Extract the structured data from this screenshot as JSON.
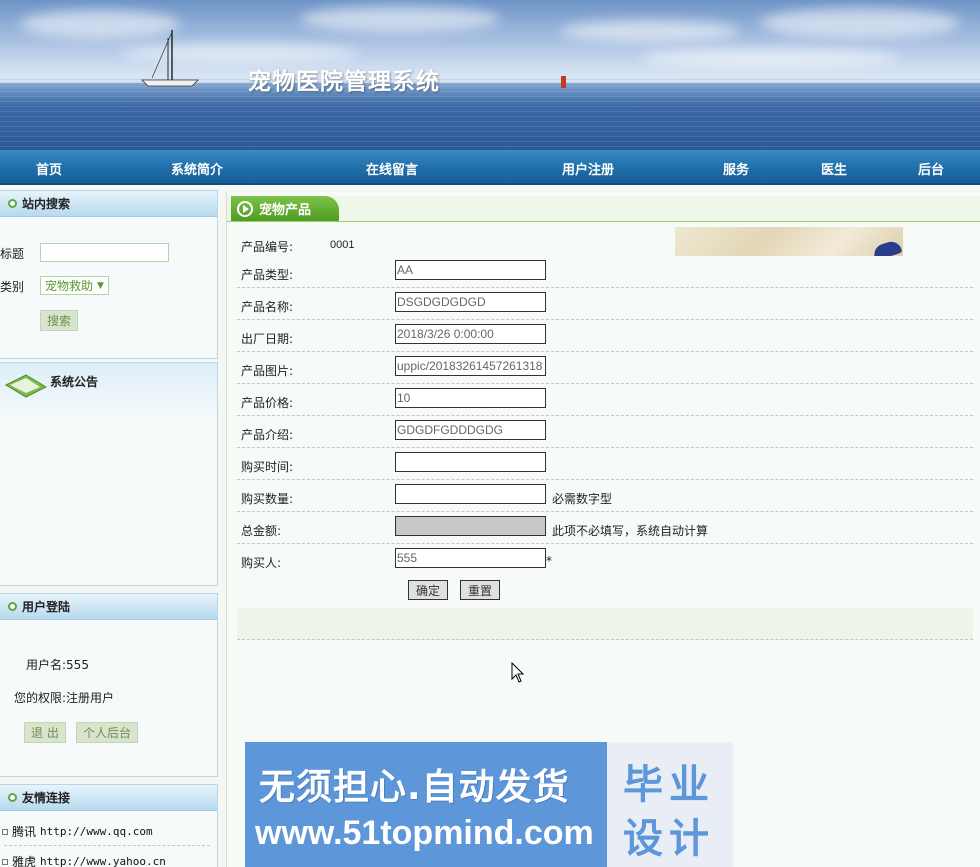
{
  "header": {
    "title": "宠物医院管理系统"
  },
  "nav": {
    "items": [
      "首页",
      "系统简介",
      "在线留言",
      "用户注册",
      "服务",
      "医生",
      "后台"
    ]
  },
  "sidebar": {
    "search": {
      "heading": "站内搜索",
      "title_label": "标题",
      "title_value": "",
      "category_label": "类别",
      "category_value": "宠物救助",
      "search_button": "搜索"
    },
    "notice": {
      "heading": "系统公告"
    },
    "login": {
      "heading": "用户登陆",
      "username_text": "用户名:555",
      "role_text": "您的权限:注册用户",
      "logout_button": "退 出",
      "personal_button": "个人后台"
    },
    "links": {
      "heading": "友情连接",
      "items": [
        {
          "name": "腾讯",
          "url": "http://www.qq.com"
        },
        {
          "name": "雅虎",
          "url": "http://www.yahoo.cn"
        }
      ]
    }
  },
  "main": {
    "tab_label": "宠物产品",
    "product_code_label": "产品编号:",
    "product_code_value": "0001",
    "fields": [
      {
        "label": "产品类型:",
        "value": "AA"
      },
      {
        "label": "产品名称:",
        "value": "DSGDGDGDGD"
      },
      {
        "label": "出厂日期:",
        "value": "2018/3/26 0:00:00"
      },
      {
        "label": "产品图片:",
        "value": "uppic/20183261457261318"
      },
      {
        "label": "产品价格:",
        "value": "10"
      },
      {
        "label": "产品介绍:",
        "value": "GDGDFGDDDGDG"
      },
      {
        "label": "购买时间:",
        "value": ""
      },
      {
        "label": "购买数量:",
        "value": "",
        "note": "必需数字型"
      },
      {
        "label": "总金额:",
        "value": "",
        "note": "此项不必填写，系统自动计算"
      },
      {
        "label": "购买人:",
        "value": "555",
        "note": "*"
      }
    ],
    "confirm_button": "确定",
    "reset_button": "重置"
  },
  "watermark": {
    "line1": "无须担心.自动发货",
    "line2": "www.51topmind.com",
    "box_line1": "毕业",
    "box_line2": "设计"
  },
  "colors": {
    "nav_blue": "#1f6ea9",
    "tab_green": "#4e9b22",
    "watermark_blue": "#5d96d9"
  }
}
